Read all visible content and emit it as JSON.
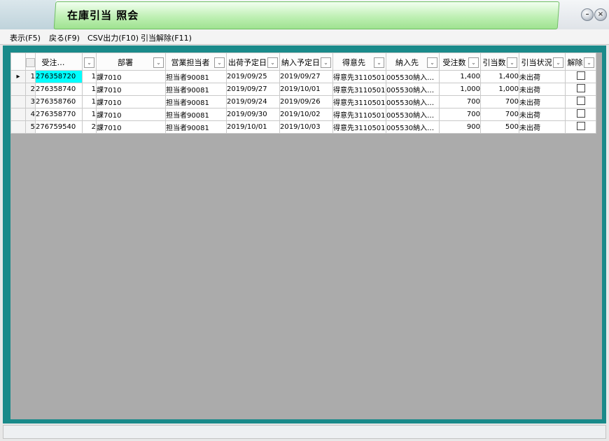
{
  "window": {
    "title": "在庫引当 照会",
    "minimize_glyph": "–",
    "close_glyph": "×"
  },
  "menu": [
    {
      "label": "表示(F5)"
    },
    {
      "label": "戻る(F9)"
    },
    {
      "label": "CSV出力(F10)"
    },
    {
      "label": "引当解除(F11)"
    }
  ],
  "grid": {
    "columns": [
      {
        "key": "order_no",
        "label": "受注…"
      },
      {
        "key": "line",
        "label": ""
      },
      {
        "key": "dept",
        "label": "部署"
      },
      {
        "key": "sales_rep",
        "label": "営業担当者"
      },
      {
        "key": "ship_date",
        "label": "出荷予定日"
      },
      {
        "key": "delivery_date",
        "label": "納入予定日"
      },
      {
        "key": "customer",
        "label": "得意先"
      },
      {
        "key": "ship_to",
        "label": "納入先"
      },
      {
        "key": "order_qty",
        "label": "受注数"
      },
      {
        "key": "alloc_qty",
        "label": "引当数"
      },
      {
        "key": "alloc_status",
        "label": "引当状況"
      },
      {
        "key": "release",
        "label": "解除"
      }
    ],
    "current_row_marker": "▸",
    "dropdown_glyph": "⌄",
    "rows": [
      {
        "idx": "1",
        "order_no": "276358720",
        "line": "1",
        "dept": "課7010",
        "sales_rep": "担当者90081",
        "ship_date": "2019/09/25",
        "delivery_date": "2019/09/27",
        "customer": "得意先3110501",
        "ship_to": "005530納入…",
        "order_qty": "1,400",
        "alloc_qty": "1,400",
        "alloc_status": "未出荷",
        "release_checked": false
      },
      {
        "idx": "2",
        "order_no": "276358740",
        "line": "1",
        "dept": "課7010",
        "sales_rep": "担当者90081",
        "ship_date": "2019/09/27",
        "delivery_date": "2019/10/01",
        "customer": "得意先3110501",
        "ship_to": "005530納入…",
        "order_qty": "1,000",
        "alloc_qty": "1,000",
        "alloc_status": "未出荷",
        "release_checked": false
      },
      {
        "idx": "3",
        "order_no": "276358760",
        "line": "1",
        "dept": "課7010",
        "sales_rep": "担当者90081",
        "ship_date": "2019/09/24",
        "delivery_date": "2019/09/26",
        "customer": "得意先3110501",
        "ship_to": "005530納入…",
        "order_qty": "700",
        "alloc_qty": "700",
        "alloc_status": "未出荷",
        "release_checked": false
      },
      {
        "idx": "4",
        "order_no": "276358770",
        "line": "1",
        "dept": "課7010",
        "sales_rep": "担当者90081",
        "ship_date": "2019/09/30",
        "delivery_date": "2019/10/02",
        "customer": "得意先3110501",
        "ship_to": "005530納入…",
        "order_qty": "700",
        "alloc_qty": "700",
        "alloc_status": "未出荷",
        "release_checked": false
      },
      {
        "idx": "5",
        "order_no": "276759540",
        "line": "2",
        "dept": "課7010",
        "sales_rep": "担当者90081",
        "ship_date": "2019/10/01",
        "delivery_date": "2019/10/03",
        "customer": "得意先3110501",
        "ship_to": "005530納入…",
        "order_qty": "900",
        "alloc_qty": "500",
        "alloc_status": "未出荷",
        "release_checked": false
      }
    ]
  },
  "colors": {
    "frame": "#1a8a8a",
    "selected_cell": "#00ffff",
    "title_tab": "#bff0b4"
  }
}
